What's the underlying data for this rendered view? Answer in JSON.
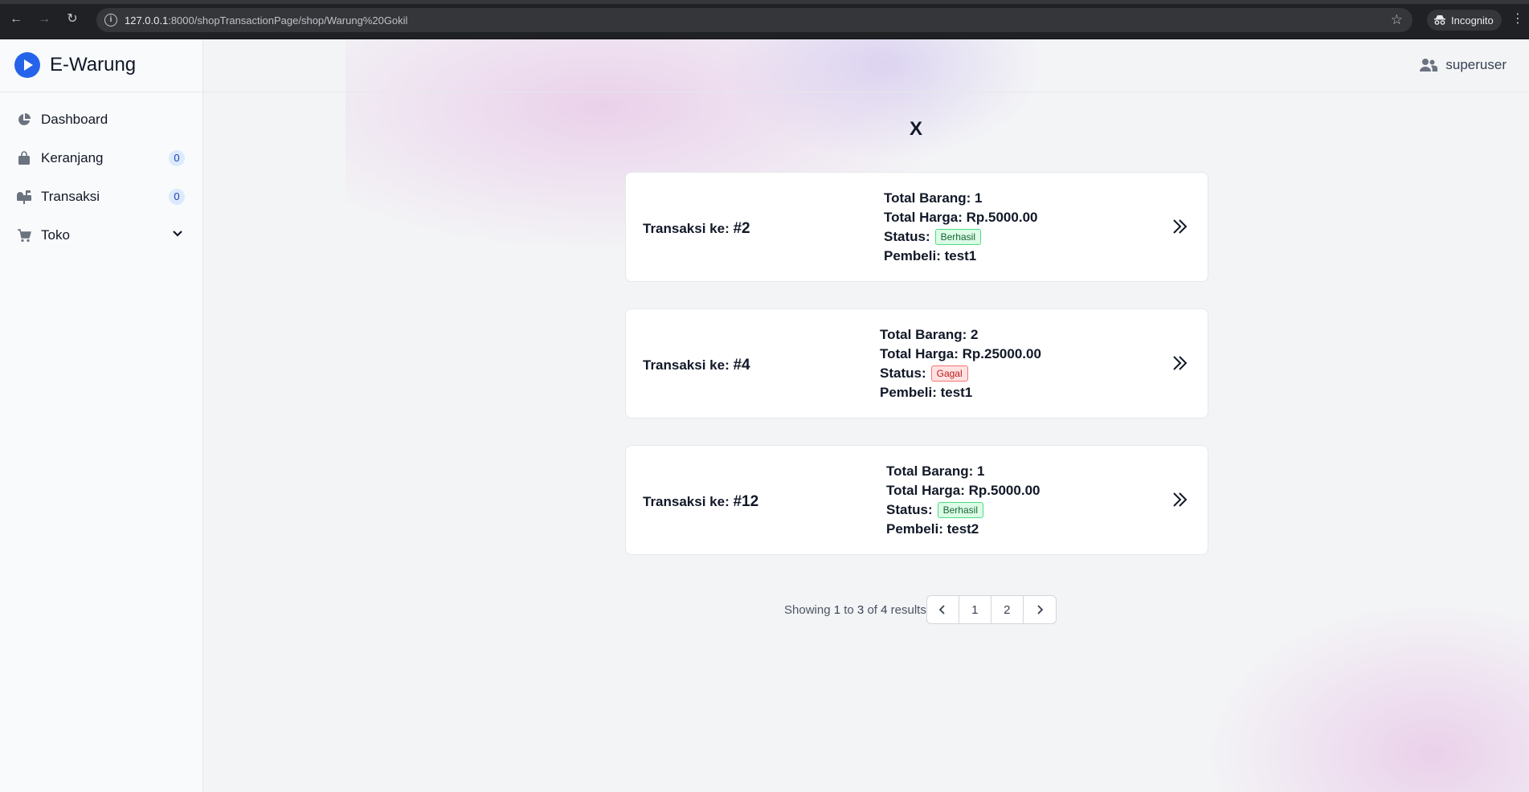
{
  "browser": {
    "url_host": "127.0.0.1",
    "url_path": ":8000/shopTransactionPage/shop/Warung%20Gokil",
    "incognito_label": "Incognito"
  },
  "sidebar": {
    "brand": "E-Warung",
    "items": [
      {
        "label": "Dashboard",
        "icon": "pie-chart-icon"
      },
      {
        "label": "Keranjang",
        "icon": "shopping-bag-icon",
        "badge": "0"
      },
      {
        "label": "Transaksi",
        "icon": "mailbox-icon",
        "badge": "0"
      },
      {
        "label": "Toko",
        "icon": "cart-icon"
      }
    ]
  },
  "topbar": {
    "username": "superuser"
  },
  "page": {
    "title": "X"
  },
  "transactions": [
    {
      "prefix": "Transaksi ke: ",
      "id": "#2",
      "total_barang": "Total Barang: 1",
      "total_harga": "Total Harga: Rp.5000.00",
      "status_label": "Status:",
      "status": "Berhasil",
      "pembeli": "Pembeli: test1"
    },
    {
      "prefix": "Transaksi ke: ",
      "id": "#4",
      "total_barang": "Total Barang: 2",
      "total_harga": "Total Harga: Rp.25000.00",
      "status_label": "Status:",
      "status": "Gagal",
      "pembeli": "Pembeli: test1"
    },
    {
      "prefix": "Transaksi ke: ",
      "id": "#12",
      "total_barang": "Total Barang: 1",
      "total_harga": "Total Harga: Rp.5000.00",
      "status_label": "Status:",
      "status": "Berhasil",
      "pembeli": "Pembeli: test2"
    }
  ],
  "pagination": {
    "showing": "Showing",
    "from": "1",
    "to_word": "to",
    "to": "3",
    "of_word": "of",
    "total": "4",
    "results_word": "results",
    "pages": [
      "1",
      "2"
    ]
  },
  "colors": {
    "accent": "#2563eb",
    "success_bg": "#dcfce7",
    "fail_bg": "#fee2e2"
  }
}
